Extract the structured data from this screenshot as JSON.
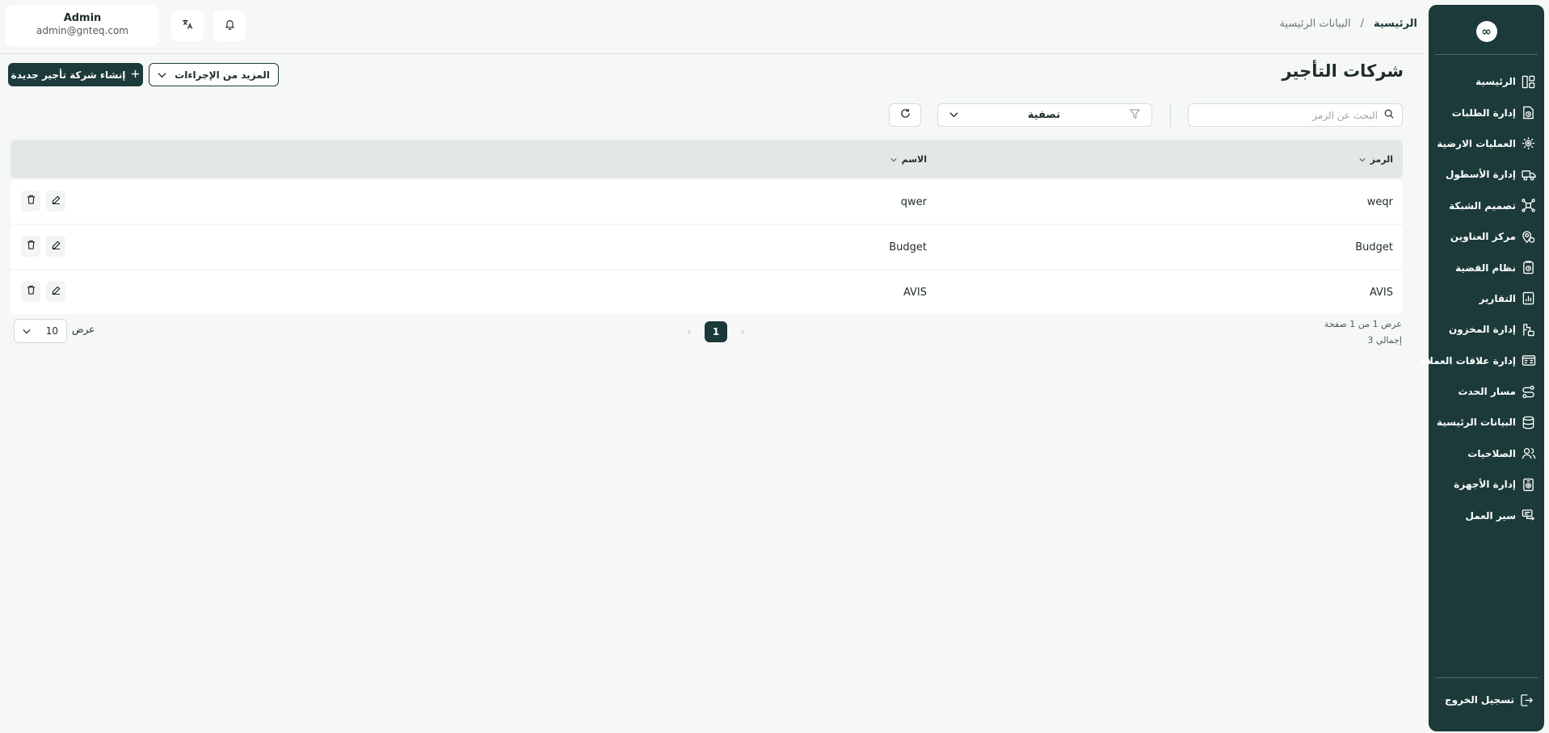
{
  "breadcrumb": {
    "home": "الرئيسية",
    "separator": "/",
    "current": "البيانات الرئيسية"
  },
  "user": {
    "name": "Admin",
    "email": "admin@gnteq.com"
  },
  "page": {
    "title": "شركات التأجير",
    "create_button": "إنشاء شركة تأجير جديدة",
    "more_actions_button": "المزيد من الإجراءات"
  },
  "toolbar": {
    "search_placeholder": "البحث عن الرمز",
    "filter_label": "تصفية"
  },
  "table": {
    "columns": {
      "code": "الرمز",
      "name": "الاسم"
    },
    "rows": [
      {
        "code": "weqr",
        "name": "qwer"
      },
      {
        "code": "Budget",
        "name": "Budget"
      },
      {
        "code": "AVIS",
        "name": "AVIS"
      }
    ]
  },
  "pagination": {
    "page_info": "عرض 1 من 1 صفحة",
    "total": "إجمالي 3",
    "current_page": "1",
    "page_size": "10",
    "page_size_label": "عرض",
    "prev_arrow": "‹",
    "next_arrow": "›"
  },
  "sidebar": {
    "logo": "∞",
    "items": [
      {
        "label": "الرئيسية",
        "icon": "dashboard-icon"
      },
      {
        "label": "إدارة الطلبات",
        "icon": "order-document-icon"
      },
      {
        "label": "العمليات الارضية",
        "icon": "ground-operations-icon"
      },
      {
        "label": "إدارة الأسطول",
        "icon": "truck-icon"
      },
      {
        "label": "تصميم الشبكة",
        "icon": "network-icon"
      },
      {
        "label": "مركز العناوين",
        "icon": "location-pin-icon"
      },
      {
        "label": "نظام القضية",
        "icon": "case-file-icon"
      },
      {
        "label": "التقارير",
        "icon": "report-icon"
      },
      {
        "label": "إدارة المخزون",
        "icon": "inventory-icon"
      },
      {
        "label": "إدارة علاقات العملاء",
        "icon": "crm-icon"
      },
      {
        "label": "مسار الحدث",
        "icon": "event-route-icon"
      },
      {
        "label": "البيانات الرئيسية",
        "icon": "database-icon"
      },
      {
        "label": "الصلاحيات",
        "icon": "users-icon"
      },
      {
        "label": "إدارة الأجهزة",
        "icon": "device-icon"
      },
      {
        "label": "سير العمل",
        "icon": "workflow-icon"
      }
    ],
    "logout": "تسجيل الخروج"
  },
  "colors": {
    "primary": "#1b3a39",
    "background": "#f6f8f7",
    "header_row": "#e3e8e6"
  }
}
